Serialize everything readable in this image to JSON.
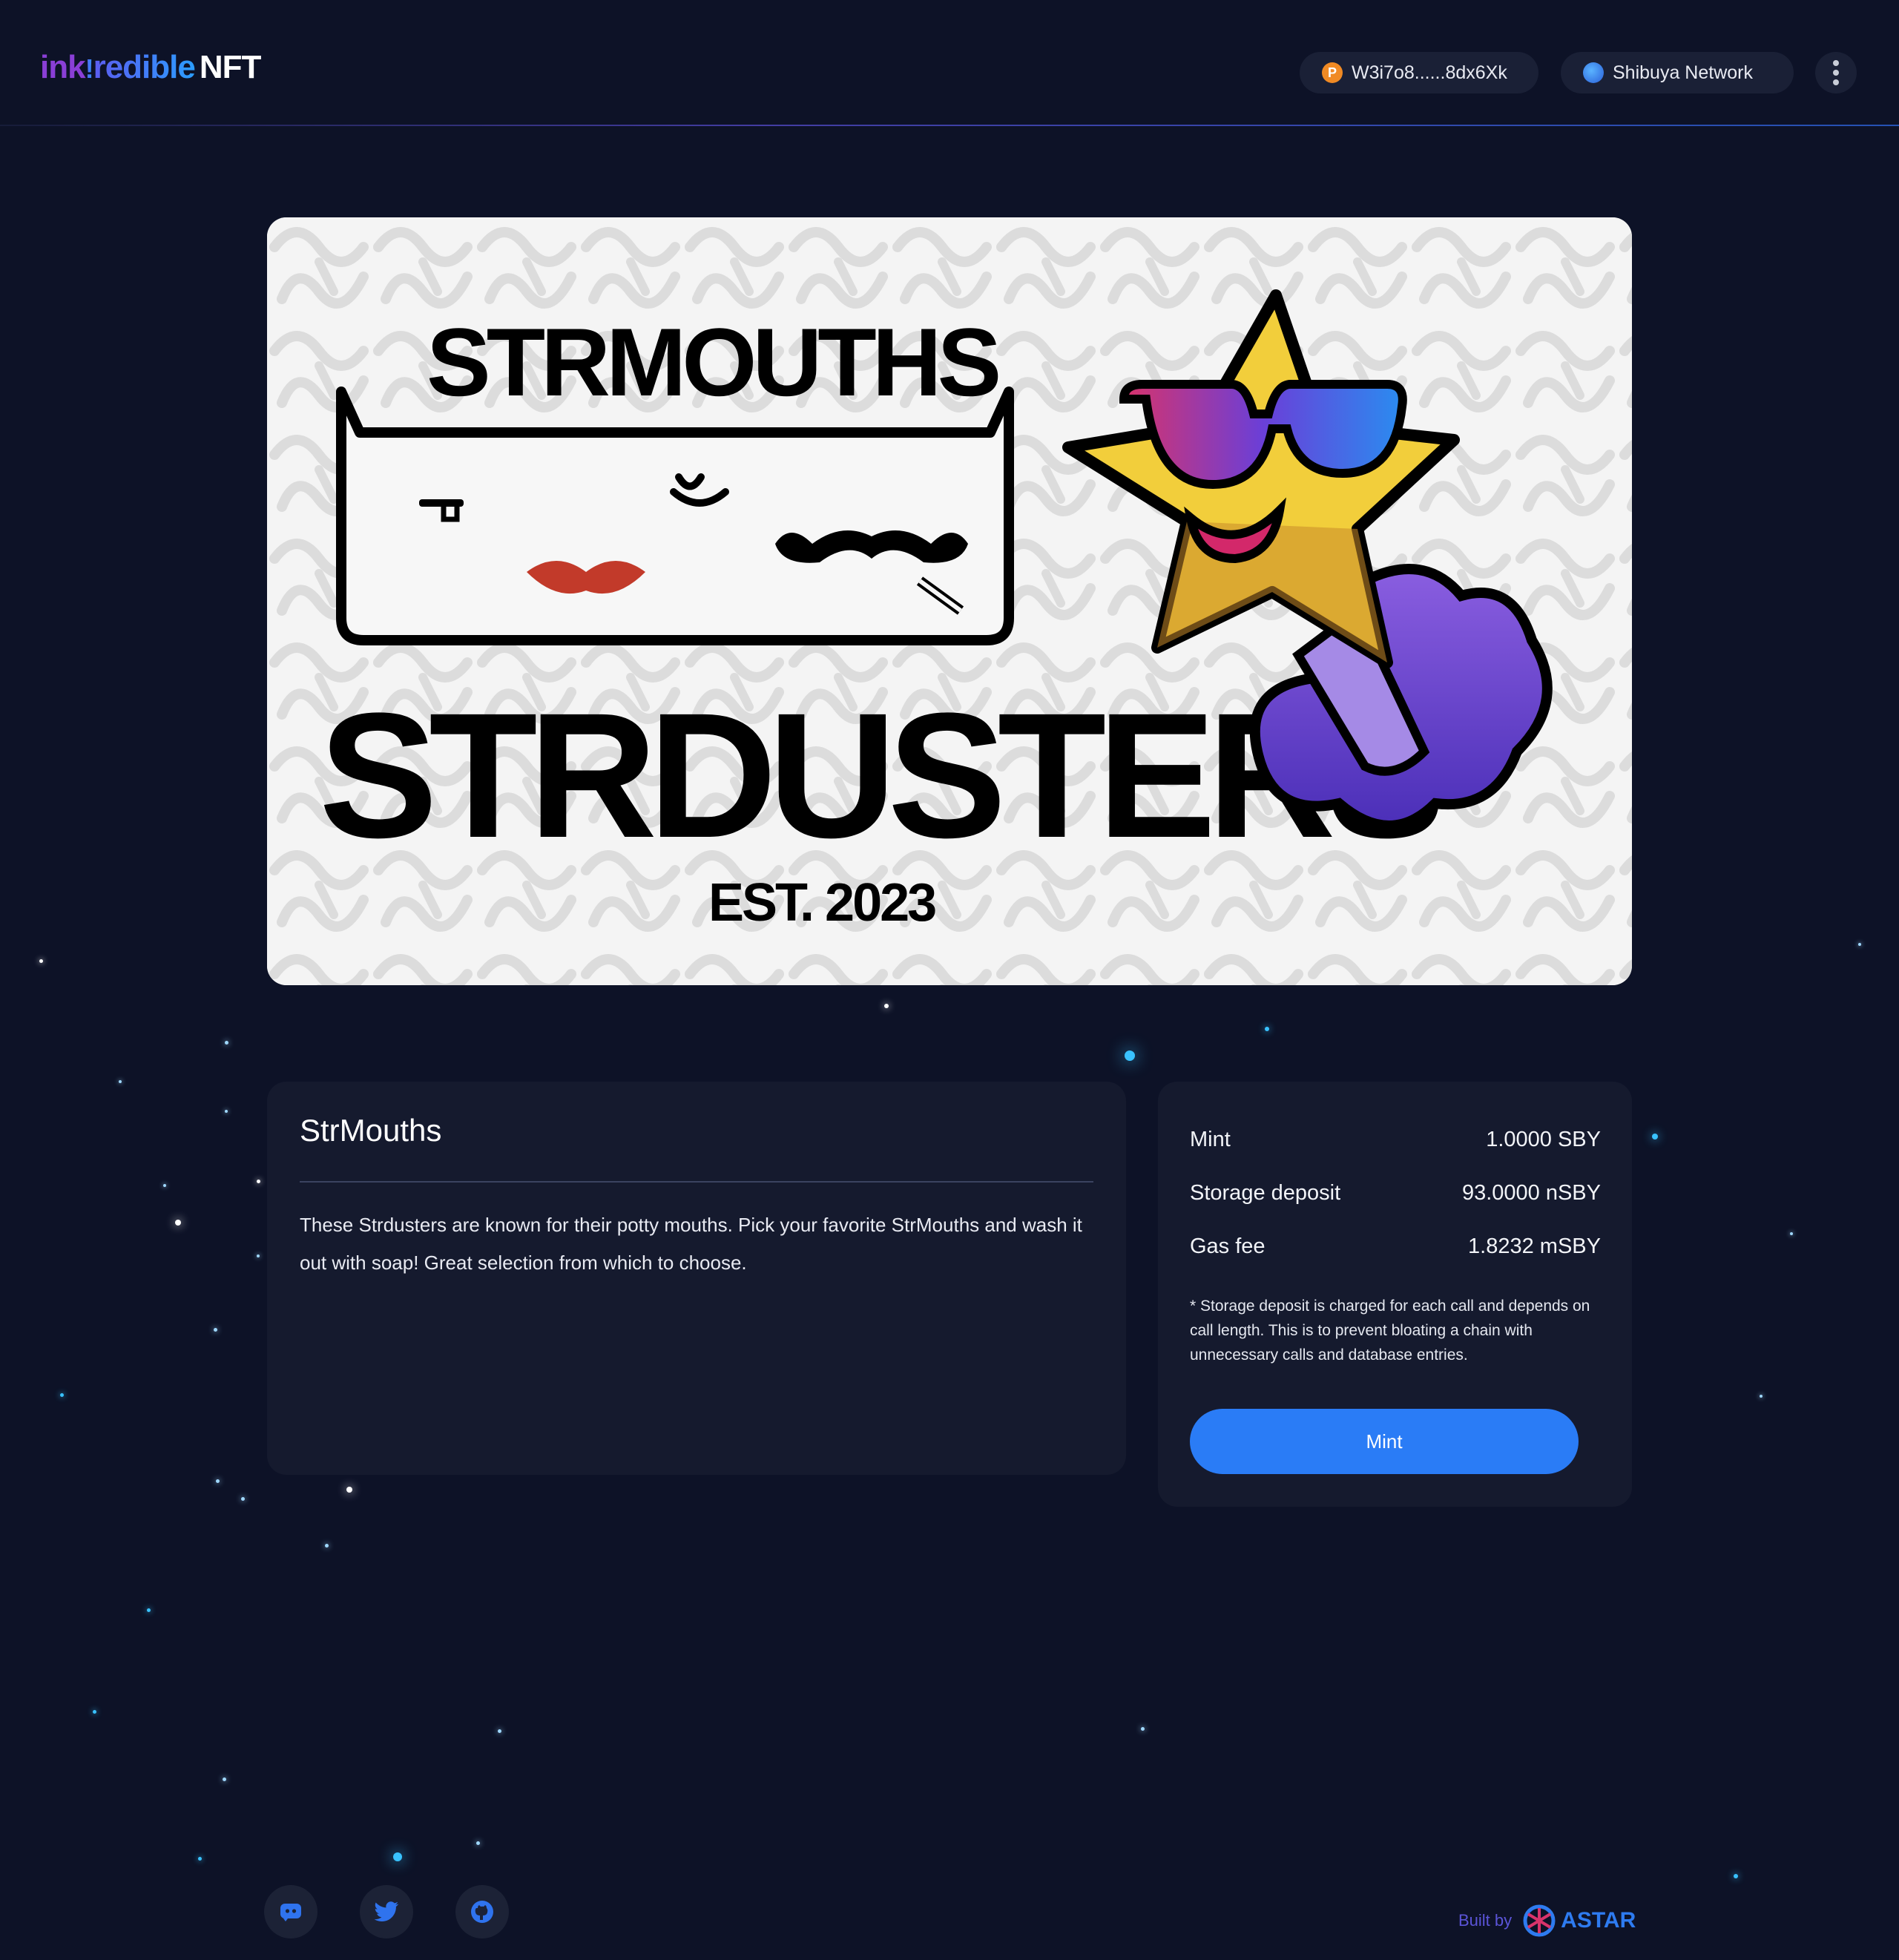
{
  "header": {
    "logo": {
      "part1": "ink",
      "part2": "!",
      "part3": "redible",
      "part4": "NFT"
    },
    "wallet": {
      "label": "W3i7o8......8dx6Xk",
      "icon": "polkadot-icon"
    },
    "network": {
      "label": "Shibuya Network",
      "icon": "shibuya-network-icon"
    },
    "menu_icon": "more-vertical-icon"
  },
  "banner": {
    "title_top": "STRMOUTHS",
    "title_main": "STRDUSTERS",
    "established": "EST. 2023"
  },
  "collection": {
    "name": "StrMouths",
    "description": "These Strdusters are known for their potty mouths. Pick your favorite StrMouths and wash it out with soap! Great selection from which to choose."
  },
  "mint_panel": {
    "rows": [
      {
        "label": "Mint",
        "value": "1.0000 SBY"
      },
      {
        "label": "Storage deposit",
        "value": "93.0000 nSBY"
      },
      {
        "label": "Gas fee",
        "value": "1.8232 mSBY"
      }
    ],
    "note": "* Storage deposit is charged for each call and depends on call length. This is to prevent bloating a chain with unnecessary calls and database entries.",
    "button_label": "Mint"
  },
  "footer": {
    "social": [
      {
        "name": "discord-icon"
      },
      {
        "name": "twitter-icon"
      },
      {
        "name": "github-icon"
      }
    ],
    "built_by": "Built by",
    "brand": "ASTAR"
  },
  "colors": {
    "background": "#0d1227",
    "card": "#151a2e",
    "accent": "#2a7cf6",
    "star_blue": "#39c2ff"
  }
}
